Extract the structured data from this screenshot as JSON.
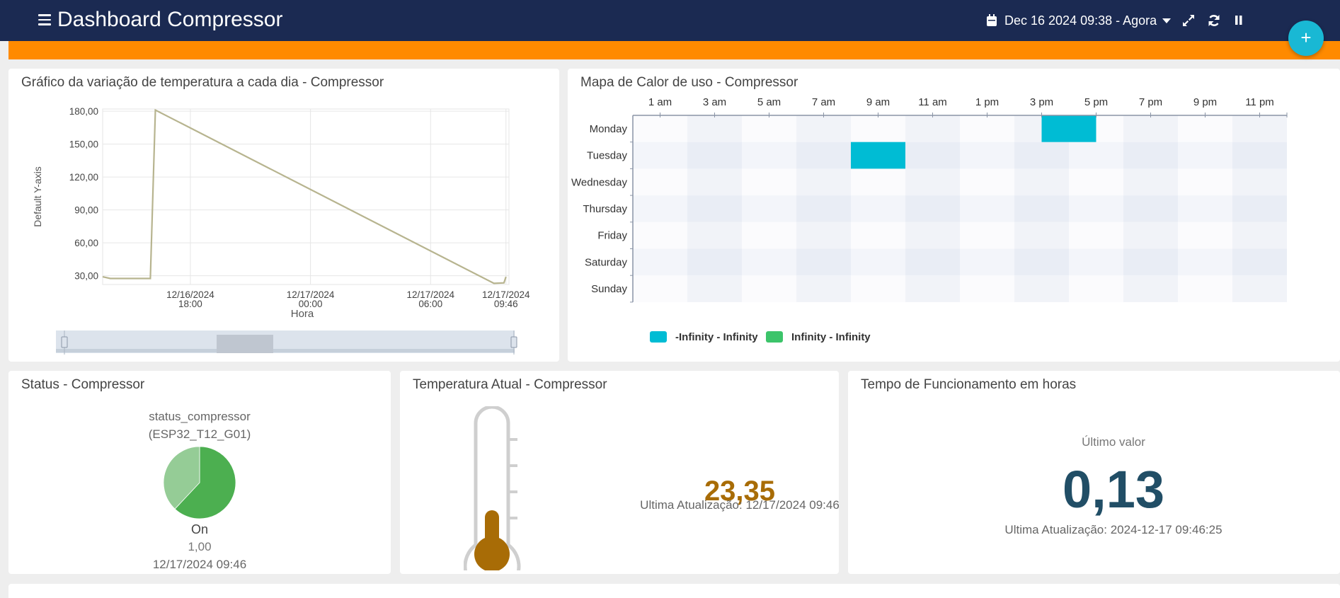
{
  "header": {
    "title": "Dashboard Compressor",
    "date_range": "Dec 16 2024 09:38 - Agora",
    "icons": [
      "menu-icon",
      "calendar-icon",
      "caret-down-icon",
      "expand-icon",
      "refresh-icon",
      "pause-icon",
      "plus-icon"
    ],
    "fab_label": "+"
  },
  "colors": {
    "header_bg": "#1b2a52",
    "accent_bar": "#ff8a00",
    "line": "#b7b48f",
    "heat_cyan": "#00bcd4",
    "heat_green": "#3cc46a",
    "temp": "#a86c06",
    "big_value": "#214e66"
  },
  "panels": {
    "temperature_chart": {
      "title": "Gráfico da variação de temperatura a cada dia - Compressor"
    },
    "heatmap": {
      "title": "Mapa de Calor de uso - Compressor"
    },
    "status": {
      "title": "Status - Compressor",
      "variable": "status_compressor",
      "device": "(ESP32_T12_G01)",
      "state": "On",
      "value": "1,00",
      "timestamp": "12/17/2024 09:46"
    },
    "current_temp": {
      "title": "Temperatura Atual - Compressor",
      "value": "23,35",
      "updated": "Ultima Atualização: 12/17/2024 09:46"
    },
    "runtime": {
      "title": "Tempo de Funcionamento em horas",
      "label": "Último valor",
      "value": "0,13",
      "updated": "Ultima Atualização: 2024-12-17 09:46:25"
    }
  },
  "chart_data": [
    {
      "type": "line",
      "title": "Gráfico da variação de temperatura a cada dia - Compressor",
      "xlabel": "Hora",
      "ylabel": "Default Y-axis",
      "yticks": [
        "180,00",
        "150,00",
        "120,00",
        "90,00",
        "60,00",
        "30,00"
      ],
      "ytick_values": [
        180,
        150,
        120,
        90,
        60,
        30
      ],
      "ylim": [
        22,
        182
      ],
      "xlim": [
        "12/16/2024 13:37",
        "12/17/2024 09:55"
      ],
      "xticks": [
        {
          "line1": "12/16/2024",
          "line2": "18:00",
          "t": "12/16/2024 18:00"
        },
        {
          "line1": "12/17/2024",
          "line2": "00:00",
          "t": "12/17/2024 00:00"
        },
        {
          "line1": "12/17/2024",
          "line2": "06:00",
          "t": "12/17/2024 06:00"
        },
        {
          "line1": "12/17/2024",
          "line2": "09:46",
          "t": "12/17/2024 09:46"
        }
      ],
      "series": [
        {
          "points": [
            {
              "x": "12/16/2024 13:37",
              "y": 29
            },
            {
              "x": "12/16/2024 14:00",
              "y": 27.5
            },
            {
              "x": "12/16/2024 16:00",
              "y": 27.5
            },
            {
              "x": "12/16/2024 16:15",
              "y": 181
            },
            {
              "x": "12/17/2024 09:10",
              "y": 23
            },
            {
              "x": "12/17/2024 09:40",
              "y": 23.5
            },
            {
              "x": "12/17/2024 09:46",
              "y": 29
            }
          ]
        }
      ],
      "grid": true
    },
    {
      "type": "heatmap",
      "title": "Mapa de Calor de uso - Compressor",
      "x_labels": [
        "1 am",
        "3 am",
        "5 am",
        "7 am",
        "9 am",
        "11 am",
        "1 pm",
        "3 pm",
        "5 pm",
        "7 pm",
        "9 pm",
        "11 pm"
      ],
      "y_labels": [
        "Monday",
        "Tuesday",
        "Wednesday",
        "Thursday",
        "Friday",
        "Saturday",
        "Sunday"
      ],
      "cells": [
        {
          "day": "Monday",
          "hour": "4 pm - 5 pm",
          "series": "-Infinity - Infinity"
        },
        {
          "day": "Tuesday",
          "hour": "9 am - 10 am",
          "series": "-Infinity - Infinity"
        }
      ],
      "legend": [
        {
          "label": "-Infinity - Infinity",
          "color": "#00bcd4"
        },
        {
          "label": "Infinity - Infinity",
          "color": "#3cc46a"
        }
      ],
      "legend_position": "bottom-left"
    },
    {
      "type": "pie",
      "title": "Status - Compressor",
      "slices": [
        {
          "label": "On",
          "value": 62,
          "color": "#4caf50"
        },
        {
          "label": "",
          "value": 38,
          "color": "#95cc96"
        }
      ]
    }
  ]
}
